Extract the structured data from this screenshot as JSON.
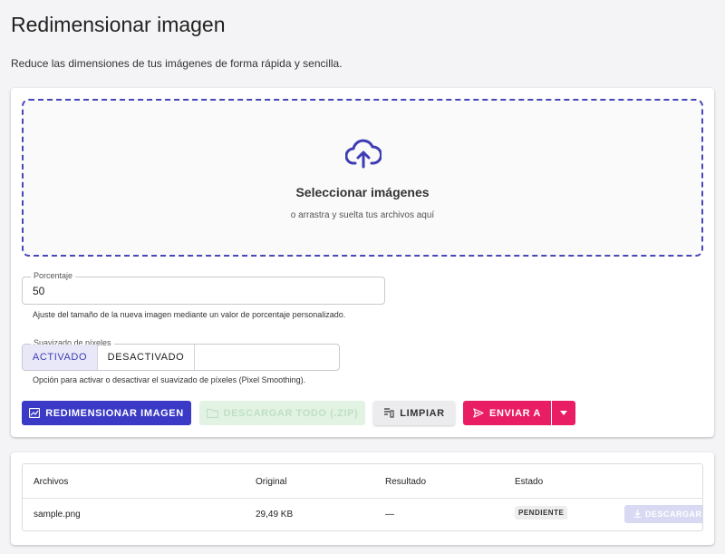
{
  "page": {
    "title": "Redimensionar imagen",
    "subtitle": "Reduce las dimensiones de tus imágenes de forma rápida y sencilla."
  },
  "dropzone": {
    "icon": "cloud-upload-icon",
    "title": "Seleccionar imágenes",
    "subtitle": "o arrastra y suelta tus archivos aquí"
  },
  "percentage": {
    "label": "Porcentaje",
    "value": "50",
    "hint": "Ajuste del tamaño de la nueva imagen mediante un valor de porcentaje personalizado."
  },
  "smoothing": {
    "label": "Suavizado de píxeles",
    "on_label": "ACTIVADO",
    "off_label": "DESACTIVADO",
    "selected": "ACTIVADO",
    "hint": "Opción para activar o desactivar el suavizado de píxeles (Pixel Smoothing)."
  },
  "actions": {
    "resize": {
      "label": "REDIMENSIONAR IMAGEN",
      "icon": "image-resize-icon"
    },
    "download_all": {
      "label": "DESCARGAR TODO (.ZIP)",
      "icon": "folder-zip-icon",
      "disabled": true
    },
    "clear": {
      "label": "LIMPIAR",
      "icon": "clear-list-icon"
    },
    "send": {
      "label": "ENVIAR A",
      "icon": "send-icon"
    }
  },
  "files_table": {
    "columns": [
      "Archivos",
      "Original",
      "Resultado",
      "Estado"
    ],
    "rows": [
      {
        "name": "sample.png",
        "original": "29,49 KB",
        "result": "—",
        "status": "PENDIENTE",
        "download_label": "DESCARGAR"
      }
    ]
  },
  "colors": {
    "primary": "#3a3ac6",
    "dropzone_border": "#4847b8",
    "send_button": "#e91d63",
    "download_disabled": "#e2f3e4"
  }
}
